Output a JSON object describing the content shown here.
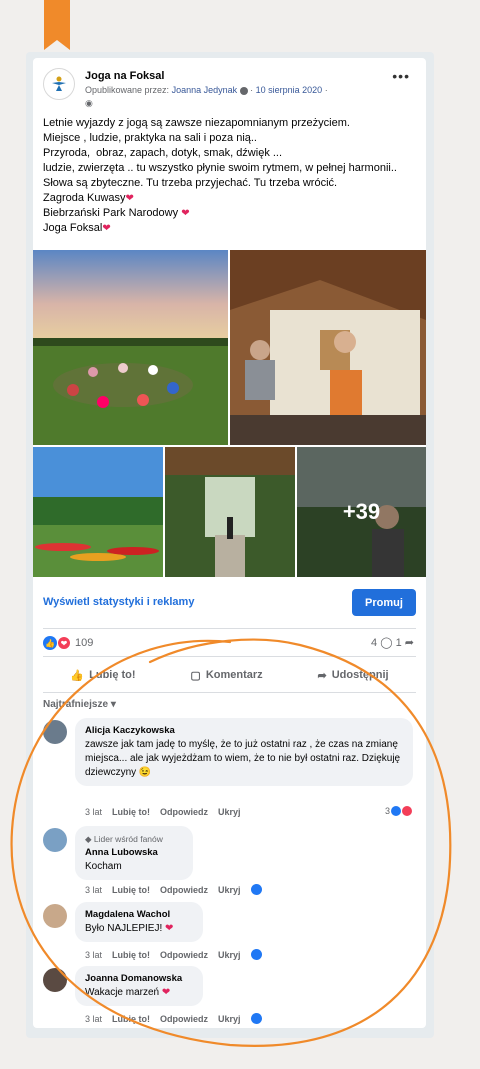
{
  "post": {
    "page_name": "Joga na Foksal",
    "published_by_label": "Opublikowane przez:",
    "author": "Joanna Jedynak",
    "date": "10 sierpnia 2020",
    "text_lines": [
      "Letnie wyjazdy z jogą są zawsze niezapomnianym przeżyciem.",
      "Miejsce , ludzie, praktyka na sali i poza nią..",
      "Przyroda,  obraz, zapach, dotyk, smak, dźwięk ...",
      "ludzie, zwierzęta .. tu wszystko płynie swoim rytmem, w pełnej harmonii..",
      "Słowa są zbyteczne. Tu trzeba przyjechać. Tu trzeba wrócić.",
      "Zagroda Kuwasy",
      "Biebrzański Park Narodowy",
      "Joga Foksal"
    ],
    "more_photos": "+39",
    "stats_link": "Wyświetl statystyki i reklamy",
    "promote": "Promuj",
    "reaction_count": "109",
    "comments_count": "4",
    "shares_count": "1",
    "actions": {
      "like": "Lubię to!",
      "comment": "Komentarz",
      "share": "Udostępnij"
    },
    "filter": "Najtrafniejsze"
  },
  "comments": [
    {
      "name": "Alicja Kaczykowska",
      "text": "zawsze jak tam jadę to myślę, że to już ostatni raz , że czas na zmianę miejsca... ale jak wyjeżdżam to wiem, że to nie był ostatni raz. Dziękuję dziewczyny 😉",
      "time": "3 lat",
      "like": "Lubię to!",
      "reply": "Odpowiedz",
      "hide": "Ukryj",
      "reactions": "3"
    },
    {
      "badge": "Lider wśród fanów",
      "name": "Anna Lubowska",
      "text": "Kocham",
      "time": "3 lat",
      "like": "Lubię to!",
      "reply": "Odpowiedz",
      "hide": "Ukryj"
    },
    {
      "name": "Magdalena Wachol",
      "text": "Było NAJLEPIEJ!",
      "time": "3 lat",
      "like": "Lubię to!",
      "reply": "Odpowiedz",
      "hide": "Ukryj"
    },
    {
      "name": "Joanna Domanowska",
      "text": "Wakacje marzeń",
      "time": "3 lat",
      "like": "Lubię to!",
      "reply": "Odpowiedz",
      "hide": "Ukryj"
    }
  ],
  "colors": {
    "accent": "#216fdb",
    "bookmark": "#f08a2a",
    "annotation": "#f08a2a",
    "love": "#f33e58"
  }
}
